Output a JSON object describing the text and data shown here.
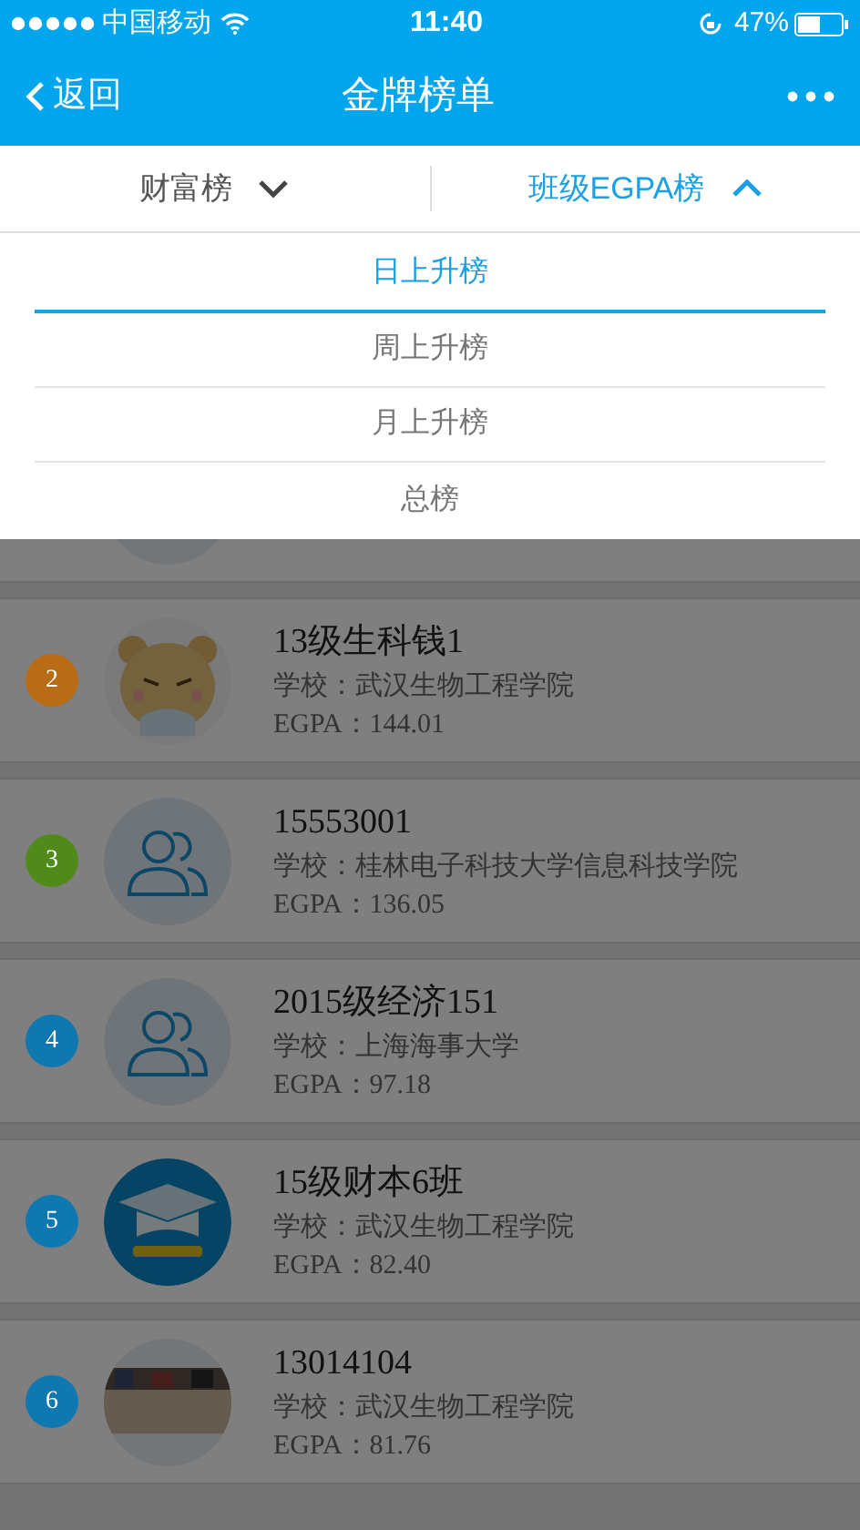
{
  "status_bar": {
    "carrier": "中国移动",
    "time": "11:40",
    "battery": "47%"
  },
  "nav": {
    "back": "返回",
    "title": "金牌榜单"
  },
  "tabs": [
    {
      "label": "财富榜",
      "selected": false
    },
    {
      "label": "班级EGPA榜",
      "selected": true
    }
  ],
  "dropdown": {
    "items": [
      {
        "label": "日上升榜",
        "selected": true
      },
      {
        "label": "周上升榜",
        "selected": false
      },
      {
        "label": "月上升榜",
        "selected": false
      },
      {
        "label": "总榜",
        "selected": false
      }
    ]
  },
  "rows": [
    {
      "avatar": {
        "kind": "picture"
      }
    },
    {
      "rank": "2",
      "color": "#b86c16",
      "avatar": {
        "kind": "bear"
      },
      "name": "13级生科钱1",
      "school": "学校：武汉生物工程学院",
      "egpa": "EGPA：144.01"
    },
    {
      "rank": "3",
      "color": "#4f8a1b",
      "avatar": {
        "kind": "group"
      },
      "name": "15553001",
      "school": "学校：桂林电子科技大学信息科技学院",
      "egpa": "EGPA：136.05"
    },
    {
      "rank": "4",
      "color": "#0f78b0",
      "avatar": {
        "kind": "group"
      },
      "name": "2015级经济151",
      "school": "学校：上海海事大学",
      "egpa": "EGPA：97.18"
    },
    {
      "rank": "5",
      "color": "#0f78b0",
      "avatar": {
        "kind": "cap"
      },
      "name": "15级财本6班",
      "school": "学校：武汉生物工程学院",
      "egpa": "EGPA：82.40"
    },
    {
      "rank": "6",
      "color": "#0f78b0",
      "avatar": {
        "kind": "picture"
      },
      "name": "13014104",
      "school": "学校：武汉生物工程学院",
      "egpa": "EGPA：81.76"
    }
  ]
}
